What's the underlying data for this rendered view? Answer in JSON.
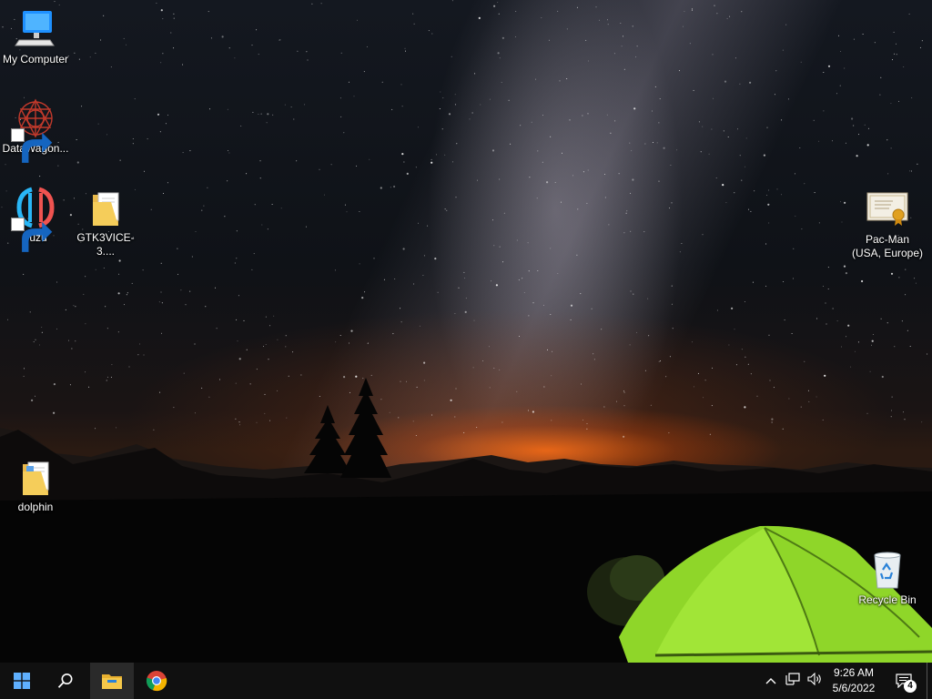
{
  "desktop": {
    "icons": [
      {
        "label": "My Computer",
        "icon": "computer-icon"
      },
      {
        "label": "DataWagon...",
        "icon": "datawagon-icon",
        "shortcut": true
      },
      {
        "label": "yuzu",
        "icon": "yuzu-icon",
        "shortcut": true
      },
      {
        "label": "GTK3VICE-3....",
        "icon": "folder-icon"
      },
      {
        "label": "dolphin",
        "icon": "folder-icon"
      },
      {
        "label": "Pac-Man\n(USA, Europe)",
        "icon": "certificate-file-icon"
      },
      {
        "label": "Recycle Bin",
        "icon": "recycle-bin-icon"
      }
    ]
  },
  "taskbar": {
    "start": "start-icon",
    "search": "search-icon",
    "pinned": [
      {
        "name": "File Explorer",
        "icon": "file-explorer-icon",
        "active": true
      },
      {
        "name": "Google Chrome",
        "icon": "chrome-icon",
        "active": false
      }
    ],
    "tray": {
      "chevron": "chevron-up-icon",
      "network": "network-icon",
      "volume": "volume-icon",
      "time": "9:26 AM",
      "date": "5/6/2022",
      "notifications_count": "4"
    }
  },
  "colors": {
    "taskbar_bg": "#101010",
    "start_blue": "#0078d7",
    "tent_green": "#8fd629"
  }
}
